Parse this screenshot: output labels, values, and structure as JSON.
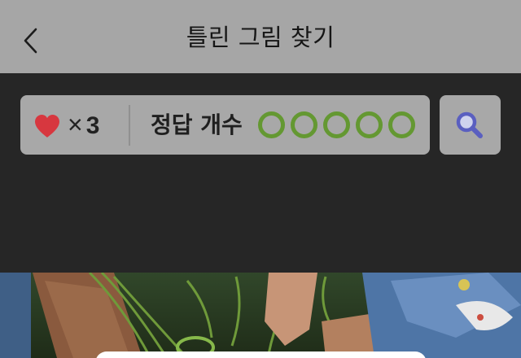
{
  "header": {
    "title": "틀린 그림 찾기",
    "back_icon": "chevron-left-icon"
  },
  "status": {
    "lives_icon": "heart-icon",
    "lives_times": "×",
    "lives_count": "3",
    "answer_label": "정답 개수",
    "answers_found": 0,
    "answers_total": 5,
    "circle_color": "#649832"
  },
  "search_button": {
    "icon": "magnifier-icon"
  },
  "colors": {
    "header_bg": "#a6a6a6",
    "body_bg": "#262626",
    "panel_bg": "#a8a8a8",
    "heart": "#d7373f",
    "magnifier": "#5a5fc0"
  }
}
